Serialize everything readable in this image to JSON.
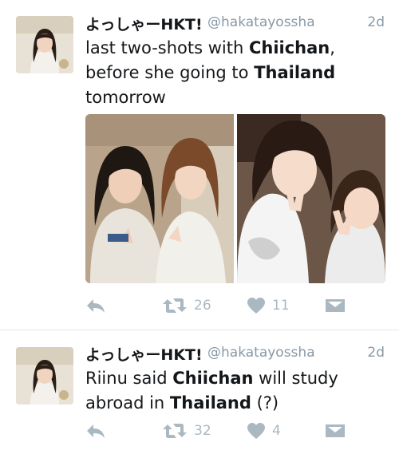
{
  "tweets": [
    {
      "display_name": "よっしゃーHKT!",
      "handle": "@hakatayossha",
      "time": "2d",
      "text_parts": [
        {
          "t": "last two-shots with ",
          "b": false
        },
        {
          "t": "Chiichan",
          "b": true
        },
        {
          "t": ",\nbefore she going to ",
          "b": false
        },
        {
          "t": "Thailand",
          "b": true
        },
        {
          "t": "\ntomorrow",
          "b": false
        }
      ],
      "has_media": true,
      "retweets": "26",
      "likes": "11"
    },
    {
      "display_name": "よっしゃーHKT!",
      "handle": "@hakatayossha",
      "time": "2d",
      "text_parts": [
        {
          "t": "Riinu said ",
          "b": false
        },
        {
          "t": "Chiichan",
          "b": true
        },
        {
          "t": " will study\nabroad in ",
          "b": false
        },
        {
          "t": "Thailand",
          "b": true
        },
        {
          "t": " (?)",
          "b": false
        }
      ],
      "has_media": false,
      "retweets": "32",
      "likes": "4"
    }
  ],
  "icons": {
    "reply": "reply-icon",
    "retweet": "retweet-icon",
    "like": "heart-icon",
    "dm": "direct-message-icon"
  },
  "colors": {
    "name": "#14171a",
    "meta": "#8899a6",
    "action": "#aab8c2",
    "divider": "#e1e8ed"
  }
}
